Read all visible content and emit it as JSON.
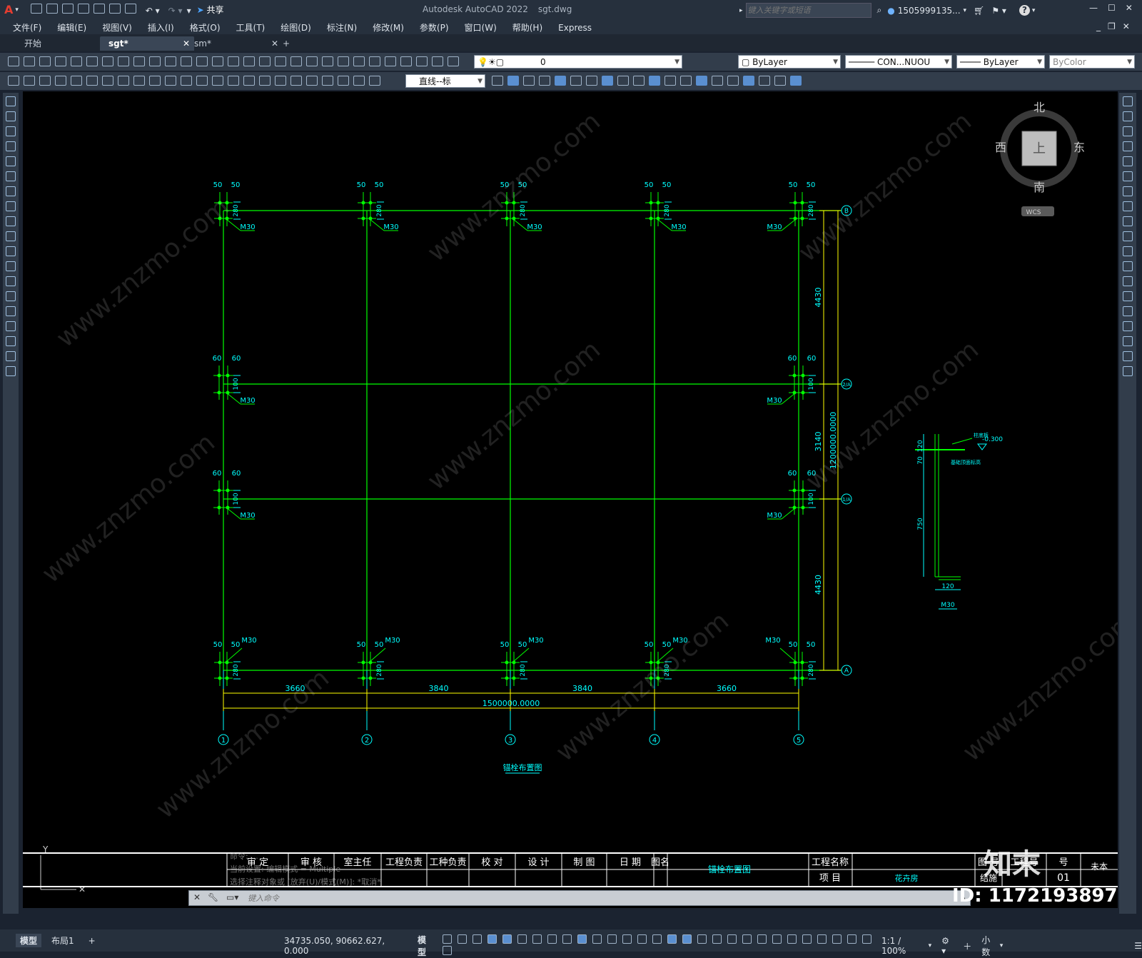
{
  "app": {
    "logo": "A",
    "title": "Autodesk AutoCAD 2022",
    "filename": "sgt.dwg",
    "share_label": "共享",
    "search_placeholder": "键入关键字或短语",
    "user": "1505999135...",
    "window_controls": [
      "—",
      "☐",
      "✕"
    ]
  },
  "menu": [
    "文件(F)",
    "编辑(E)",
    "视图(V)",
    "插入(I)",
    "格式(O)",
    "工具(T)",
    "绘图(D)",
    "标注(N)",
    "修改(M)",
    "参数(P)",
    "窗口(W)",
    "帮助(H)",
    "Express"
  ],
  "tabs": [
    {
      "label": "开始",
      "active": false
    },
    {
      "label": "sgt*",
      "active": true
    },
    {
      "label": "sm*",
      "active": false
    }
  ],
  "toolbar": {
    "layer_value": "0",
    "color_value": "ByLayer",
    "linetype_value": "CON...NUOU",
    "lineweight_value": "ByLayer",
    "plotstyle_value": "ByColor",
    "dimstyle_value": "直线--标"
  },
  "viewcube": {
    "north": "北",
    "south": "南",
    "east": "东",
    "west": "西",
    "top": "上",
    "wcs": "WCS"
  },
  "drawing": {
    "title": "锚栓布置图",
    "bolt_label": "M30",
    "spacing_top": [
      "50",
      "50"
    ],
    "spacing_mid": [
      "60",
      "60"
    ],
    "vertical_offsets_top": "280",
    "vertical_offsets_mid": "100",
    "x_dims": [
      "3660",
      "3840",
      "3840",
      "3660"
    ],
    "x_total": "1500000.0000",
    "y_dims": [
      "4430",
      "3140",
      "4430"
    ],
    "y_total": "1200000.0000",
    "axis_numbers": [
      "1",
      "2",
      "3",
      "4",
      "5"
    ],
    "axis_letters": [
      "A",
      "1/A",
      "2/A",
      "B"
    ],
    "detail": {
      "dims": [
        "120",
        "70",
        "750",
        "120"
      ],
      "elev": "-0.300",
      "note1": "柱底板",
      "note2": "基础顶面标高",
      "bolt": "M30"
    }
  },
  "title_block": {
    "headers": [
      "审 定",
      "审 核",
      "室主任",
      "工程负责",
      "工种负责",
      "校 对",
      "设 计",
      "制 图",
      "日 期"
    ],
    "drawing_name_label": "图名",
    "drawing_name": "锚栓布置图",
    "project_name_label": "工程名称",
    "project_label": "项 目",
    "project_value": "花卉房",
    "right_labels": [
      "图 号",
      "工程号",
      "号"
    ],
    "right_values": [
      "结施",
      "01"
    ],
    "version": "未本"
  },
  "command": {
    "history": [
      "命令: ...",
      "当前设置: 编辑模式 = Multiple",
      "选择注释对象或 [放弃(U)/模式(M)]: *取消*"
    ],
    "placeholder": "键入命令"
  },
  "status": {
    "layout_tabs": [
      "模型",
      "布局1"
    ],
    "coords": "34735.050, 90662.627, 0.000",
    "space": "模型",
    "scale": "1:1 / 100%",
    "units": "小数"
  },
  "watermark": {
    "brand": "知末",
    "site": "www.znzmo.com",
    "id": "ID: 1172193897"
  },
  "colors": {
    "canvas": "#000000",
    "grid": "#00ff00",
    "dim": "#00ffff",
    "ext": "#ffff00",
    "chrome": "#26303d"
  }
}
